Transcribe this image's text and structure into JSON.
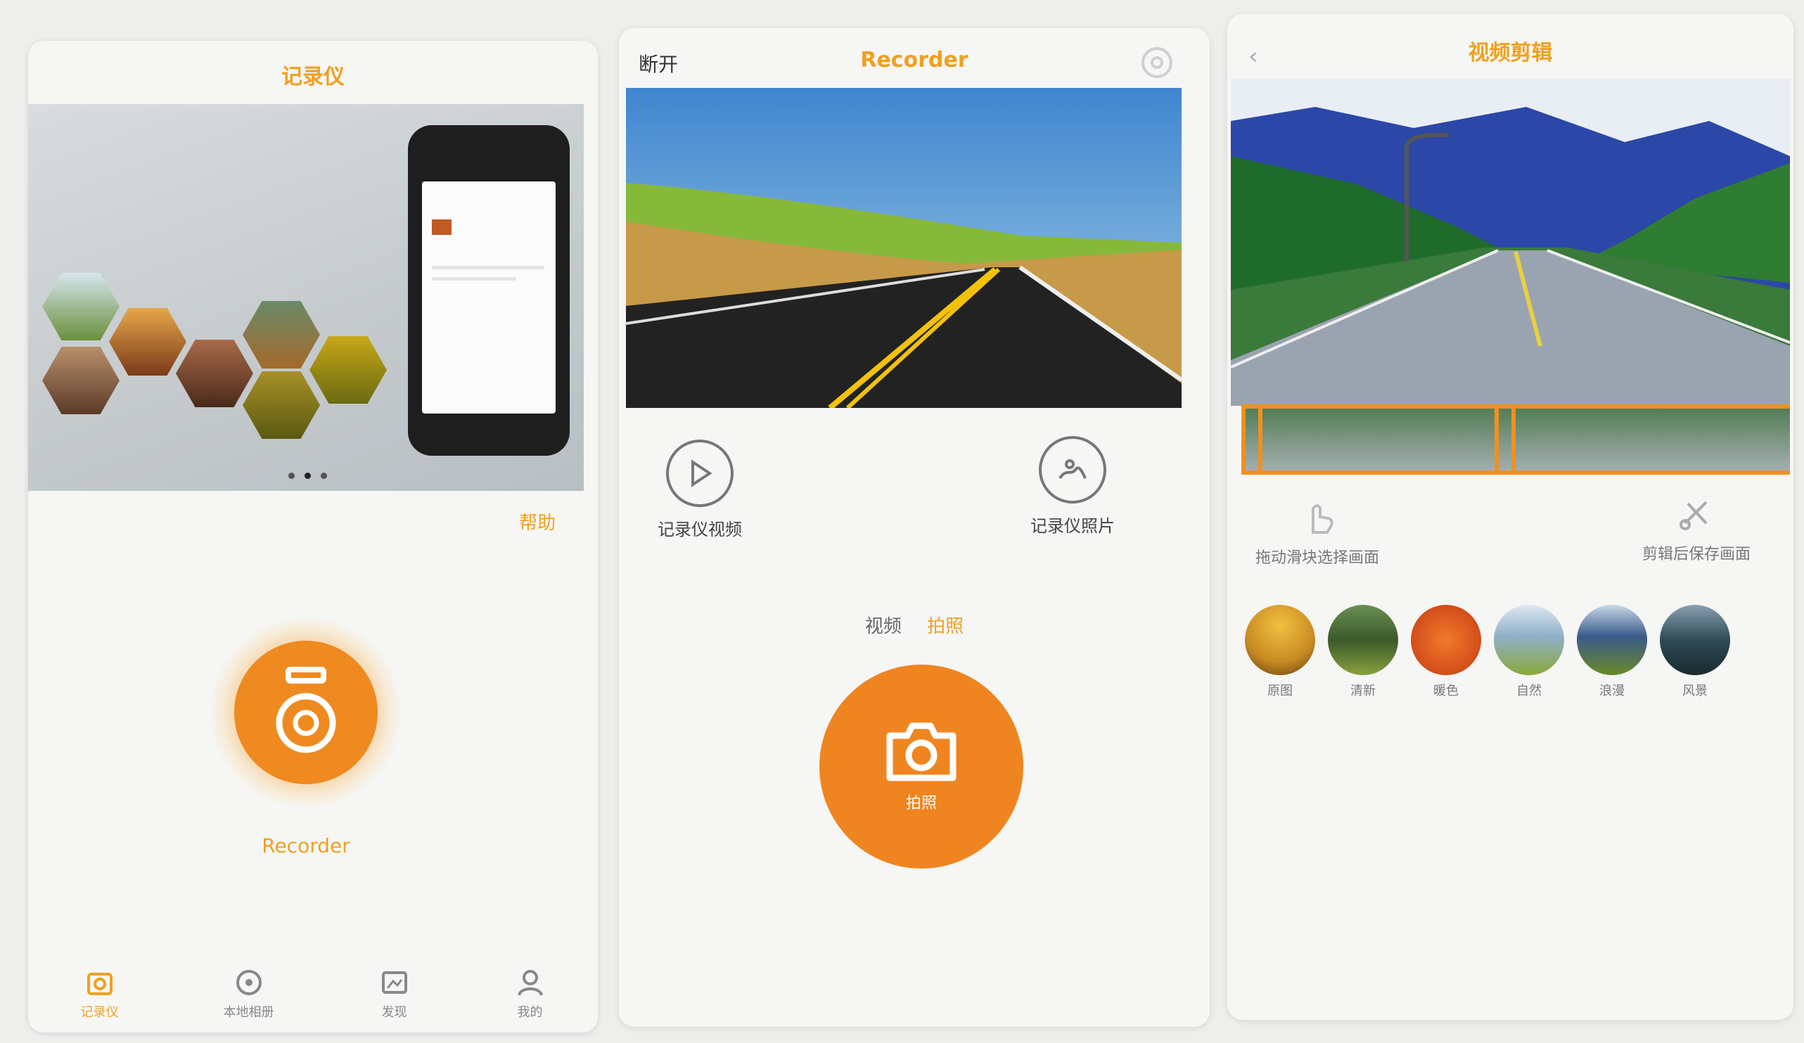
{
  "screen1": {
    "title": "记录仪",
    "help_label": "帮助",
    "connect_label": "Recorder",
    "carousel_dots": 3,
    "tabs": [
      {
        "label": "记录仪",
        "icon": "home-icon"
      },
      {
        "label": "本地相册",
        "icon": "album-icon"
      },
      {
        "label": "发现",
        "icon": "discover-icon"
      },
      {
        "label": "我的",
        "icon": "profile-icon"
      }
    ]
  },
  "screen2": {
    "back_label": "断开",
    "title": "Recorder",
    "left_action_label": "记录仪视频",
    "right_action_label": "记录仪照片",
    "mode_video": "视频",
    "mode_photo": "拍照",
    "capture_label": "拍照"
  },
  "screen3": {
    "title": "视频剪辑",
    "tool_left_label": "拖动滑块选择画面",
    "tool_right_label": "剪辑后保存画面",
    "filters": [
      {
        "label": "原图",
        "color": "#c88a22"
      },
      {
        "label": "清新",
        "color": "#496b32"
      },
      {
        "label": "暖色",
        "color": "#d84a1c"
      },
      {
        "label": "自然",
        "color": "#7f9fb8"
      },
      {
        "label": "浪漫",
        "color": "#4f6f8f"
      },
      {
        "label": "风景",
        "color": "#2e4a55"
      }
    ]
  },
  "colors": {
    "accent": "#ef8a20",
    "title_orange": "#f0a020"
  }
}
